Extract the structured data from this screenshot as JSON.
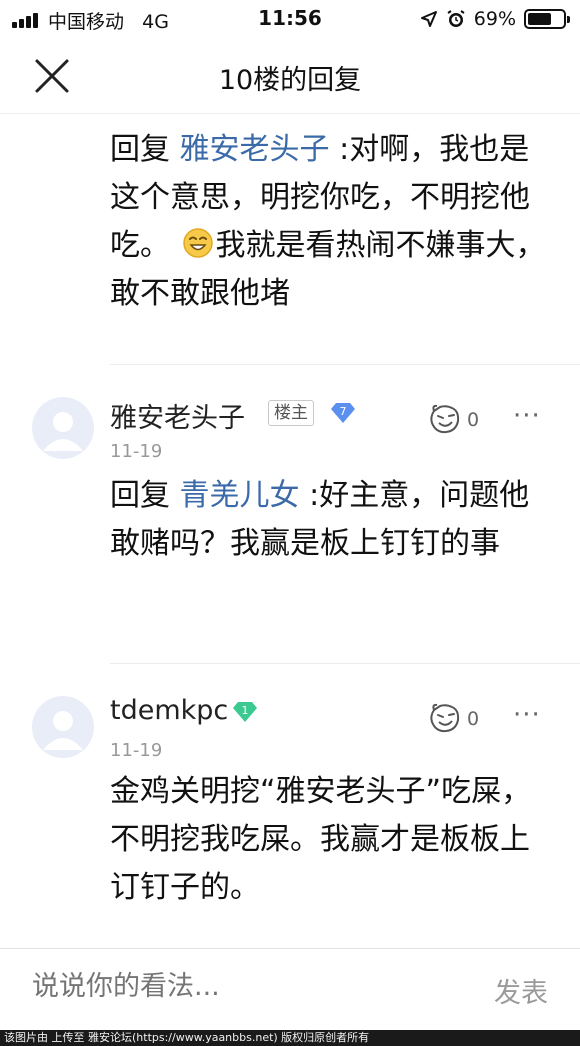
{
  "status_bar": {
    "carrier": "中国移动",
    "network": "4G",
    "time": "11:56",
    "battery": "69%",
    "battery_level": 0.69
  },
  "nav": {
    "title": "10楼的回复",
    "close_icon": "close-icon"
  },
  "first_reply": {
    "prefix": "回复 ",
    "mention": "雅安老头子",
    "text_1": " :对啊，我也是这个意思，明挖你吃，不明挖他吃。",
    "emoji": "smiley-emoji-icon",
    "text_2": "我就是看热闹不嫌事大，敢不敢跟他堵"
  },
  "posts": [
    {
      "username": "雅安老头子",
      "owner_badge": "楼主",
      "level": "7",
      "level_color": "#5b8ff0",
      "date": "11-19",
      "likes": "0",
      "reply_prefix": "回复 ",
      "mention": "青羌儿女",
      "text": " :好主意，问题他敢赌吗？我赢是板上钉钉的事"
    },
    {
      "username": "tdemkpc",
      "level": "1",
      "level_color": "#3cc98f",
      "date": "11-19",
      "likes": "0",
      "text": "金鸡关明挖“雅安老头子”吃屎，不明挖我吃屎。我赢才是板板上订钉子的。"
    }
  ],
  "bottom_bar": {
    "input_placeholder": "说说你的看法...",
    "send_label": "发表"
  },
  "watermark": "该图片由 上传至 雅安论坛(https://www.yaanbbs.net) 版权归原创者所有",
  "colors": {
    "mention": "#3b6aa8",
    "muted": "#999999"
  }
}
